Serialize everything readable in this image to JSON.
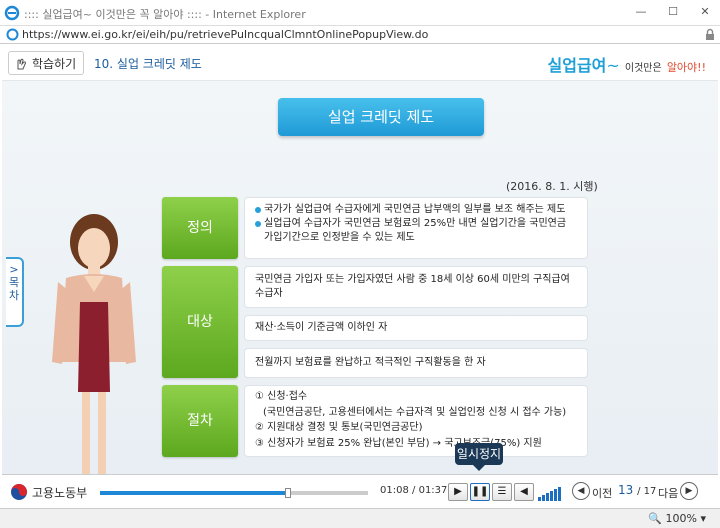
{
  "window": {
    "title": ":::: 실업급여~ 이것만은 꼭 알아야 :::: - Internet Explorer",
    "url": "https://www.ei.go.kr/ei/eih/pu/retrievePuIncqualClmntOnlinePopupView.do"
  },
  "nav": {
    "study_label": "학습하기",
    "lesson_title": "10. 실업 크레딧 제도",
    "brand_main": "실업급여",
    "brand_tilde": "~",
    "brand_sub": "이것만은",
    "brand_sub2": "알아야!!"
  },
  "side_tab": {
    "label": "목차"
  },
  "slide": {
    "title": "실업 크레딧 제도",
    "date": "(2016. 8. 1. 시행)",
    "sections": {
      "definition": {
        "label": "정의",
        "bullets": [
          "국가가 실업급여 수급자에게 국민연금 납부액의 일부를 보조 해주는 제도",
          "실업급여 수급자가 국민연금 보험료의 25%만 내면 실업기간을 국민연금 가입기간으로 인정받을 수 있는 제도"
        ]
      },
      "target": {
        "label": "대상",
        "items": [
          "국민연금 가입자 또는 가입자였던 사람 중 18세 이상 60세 미만의 구직급여 수급자",
          "재산·소득이 기준금액 이하인 자",
          "전월까지 보험료를 완납하고 적극적인 구직활동을 한 자"
        ]
      },
      "procedure": {
        "label": "절차",
        "lines": [
          "① 신청·접수",
          "(국민연금공단, 고용센터에서는 수급자격 및 실업인정 신청 시 접수 가능)",
          "② 지원대상 결정 및 통보(국민연금공단)",
          "③ 신청자가 보험료 25% 완납(본인 부담) → 국고보조금(75%) 지원"
        ]
      }
    }
  },
  "player": {
    "org": "고용노동부",
    "current_time": "01:08",
    "total_time": "01:37",
    "progress": 0.7,
    "tooltip": "일시정지",
    "prev_label": "이전",
    "next_label": "다음",
    "page_current": "13",
    "page_total": "17"
  },
  "status": {
    "zoom": "100%"
  }
}
